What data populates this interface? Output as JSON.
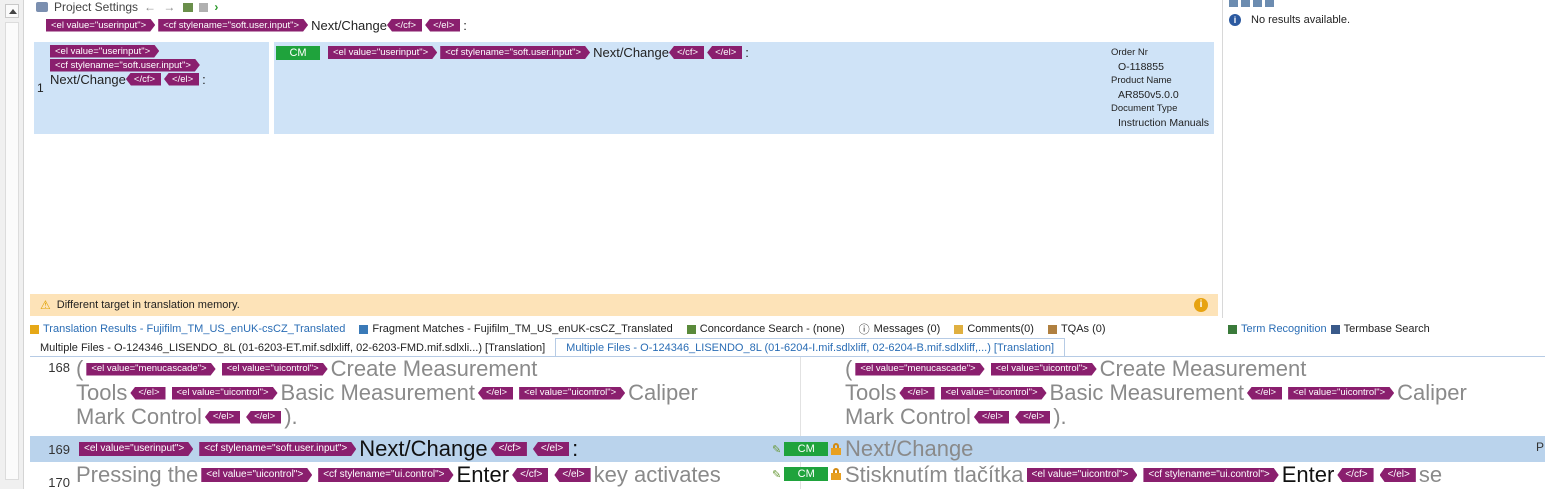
{
  "toolbar": {
    "title": "Project Settings",
    "arrows": "← →"
  },
  "source_line": {
    "tag1": "<el value=\"userinput\">",
    "tag2": "<cf stylename=\"soft.user.input\">",
    "text": "Next/Change",
    "close1": "</cf>",
    "close2": "</el>",
    "suffix": ":"
  },
  "match": {
    "number": "1",
    "src_tag1": "<el value=\"userinput\">",
    "src_tag2": "<cf stylename=\"soft.user.input\">",
    "src_text": "Next/Change",
    "close1": "</cf>",
    "close2": "</el>",
    "suffix": ":",
    "badge": "CM",
    "tgt_tag1": "<el value=\"userinput\">",
    "tgt_tag2": "<cf stylename=\"soft.user.input\">",
    "tgt_text": "Next/Change",
    "meta": {
      "order_label": "Order Nr",
      "order_value": "O-118855",
      "product_label": "Product Name",
      "product_value": "AR850v5.0.0",
      "doctype_label": "Document Type",
      "doctype_value": "Instruction Manuals"
    }
  },
  "warning": {
    "text": "Different target in translation memory."
  },
  "tabs": [
    {
      "label": "Translation Results - Fujifilm_TM_US_enUK-csCZ_Translated",
      "active": true
    },
    {
      "label": "Fragment Matches - Fujifilm_TM_US_enUK-csCZ_Translated"
    },
    {
      "label": "Concordance Search - (none)"
    },
    {
      "label": "Messages (0)"
    },
    {
      "label": "Comments(0)"
    },
    {
      "label": "TQAs (0)"
    }
  ],
  "right_panel": {
    "no_results": "No results available.",
    "tab_term": "Term Recognition",
    "tab_termbase": "Termbase Search"
  },
  "file_tabs": [
    "Multiple Files - O-124346_LISENDO_8L (01-6203-ET.mif.sdlxliff, 02-6203-FMD.mif.sdlxli...) [Translation]",
    "Multiple Files - O-124346_LISENDO_8L (01-6204-I.mif.sdlxliff, 02-6204-B.mif.sdlxliff,...) [Translation]"
  ],
  "editor": {
    "row168": {
      "num": "168",
      "open_paren": "(",
      "tag_menucascade": "<el value=\"menucascade\">",
      "tag_uicontrol": "<el value=\"uicontrol\">",
      "text1": "Create Measurement",
      "text2": "Tools",
      "tag_close_el": "</el>",
      "text3": "Basic Measurement",
      "text4": "Caliper",
      "text5": "Mark Control",
      "close_paren": ")."
    },
    "row169": {
      "num": "169",
      "tag1": "<el value=\"userinput\">",
      "tag2": "<cf stylename=\"soft.user.input\">",
      "text": "Next/Change",
      "close1": "</cf>",
      "close2": "</el>",
      "suffix": ":",
      "badge": "CM",
      "target": "Next/Change"
    },
    "row170": {
      "num": "170",
      "src_pre": "Pressing the",
      "tag1": "<el value=\"uicontrol\">",
      "tag2": "<cf stylename=\"ui.control\">",
      "key": "Enter",
      "close1": "</cf>",
      "close2": "</el>",
      "src_post": "key activates",
      "badge": "CM",
      "tgt_pre": "Stisknutím tlačítka",
      "tgt_post": "se"
    },
    "side_char": "P"
  }
}
